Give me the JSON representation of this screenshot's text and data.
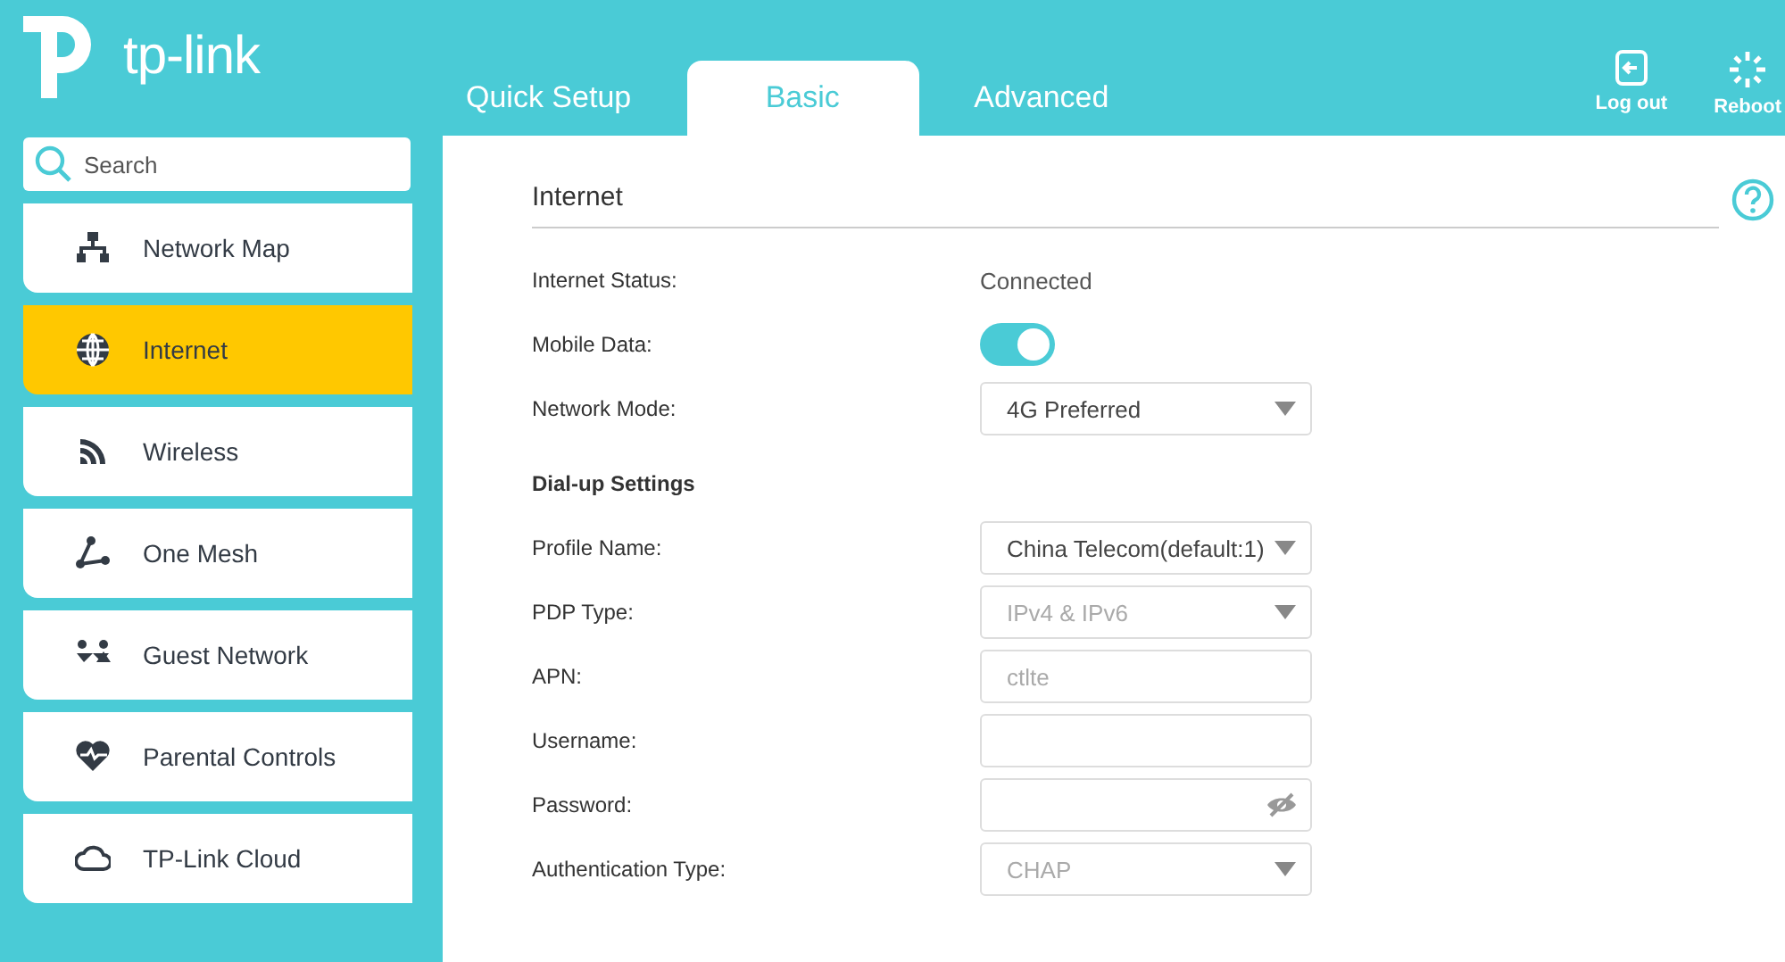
{
  "header": {
    "logo": "tp-link",
    "tabs": [
      {
        "label": "Quick Setup",
        "selected": false
      },
      {
        "label": "Basic",
        "selected": true
      },
      {
        "label": "Advanced",
        "selected": false
      }
    ],
    "actions": [
      {
        "label": "Log out",
        "kind": "logout"
      },
      {
        "label": "Reboot",
        "kind": "reboot"
      }
    ]
  },
  "sidebar": {
    "search": {
      "placeholder": "Search"
    },
    "items": [
      {
        "label": "Network Map",
        "selected": false
      },
      {
        "label": "Internet",
        "selected": true
      },
      {
        "label": "Wireless",
        "selected": false
      },
      {
        "label": "One Mesh",
        "selected": false
      },
      {
        "label": "Guest Network",
        "selected": false
      },
      {
        "label": "Parental Controls",
        "selected": false
      },
      {
        "label": "TP-Link Cloud",
        "selected": false
      }
    ]
  },
  "main": {
    "title": "Internet",
    "rows": [
      {
        "kind": "text",
        "label": "Internet Status:",
        "value": "Connected"
      },
      {
        "kind": "toggle",
        "label": "Mobile Data:",
        "on": true
      },
      {
        "kind": "select",
        "label": "Network Mode:",
        "value": "4G Preferred",
        "disabled": false
      }
    ],
    "dialup": {
      "title": "Dial-up Settings",
      "rows": [
        {
          "kind": "select",
          "label": "Profile Name:",
          "value": "China Telecom(default:1)",
          "disabled": false
        },
        {
          "kind": "select",
          "label": "PDP Type:",
          "value": "IPv4 & IPv6",
          "disabled": true
        },
        {
          "kind": "input",
          "label": "APN:",
          "value": "ctlte",
          "disabled": true
        },
        {
          "kind": "input",
          "label": "Username:"
        },
        {
          "kind": "password",
          "label": "Password:"
        },
        {
          "kind": "select",
          "label": "Authentication Type:",
          "value": "CHAP",
          "disabled": true
        }
      ]
    }
  }
}
